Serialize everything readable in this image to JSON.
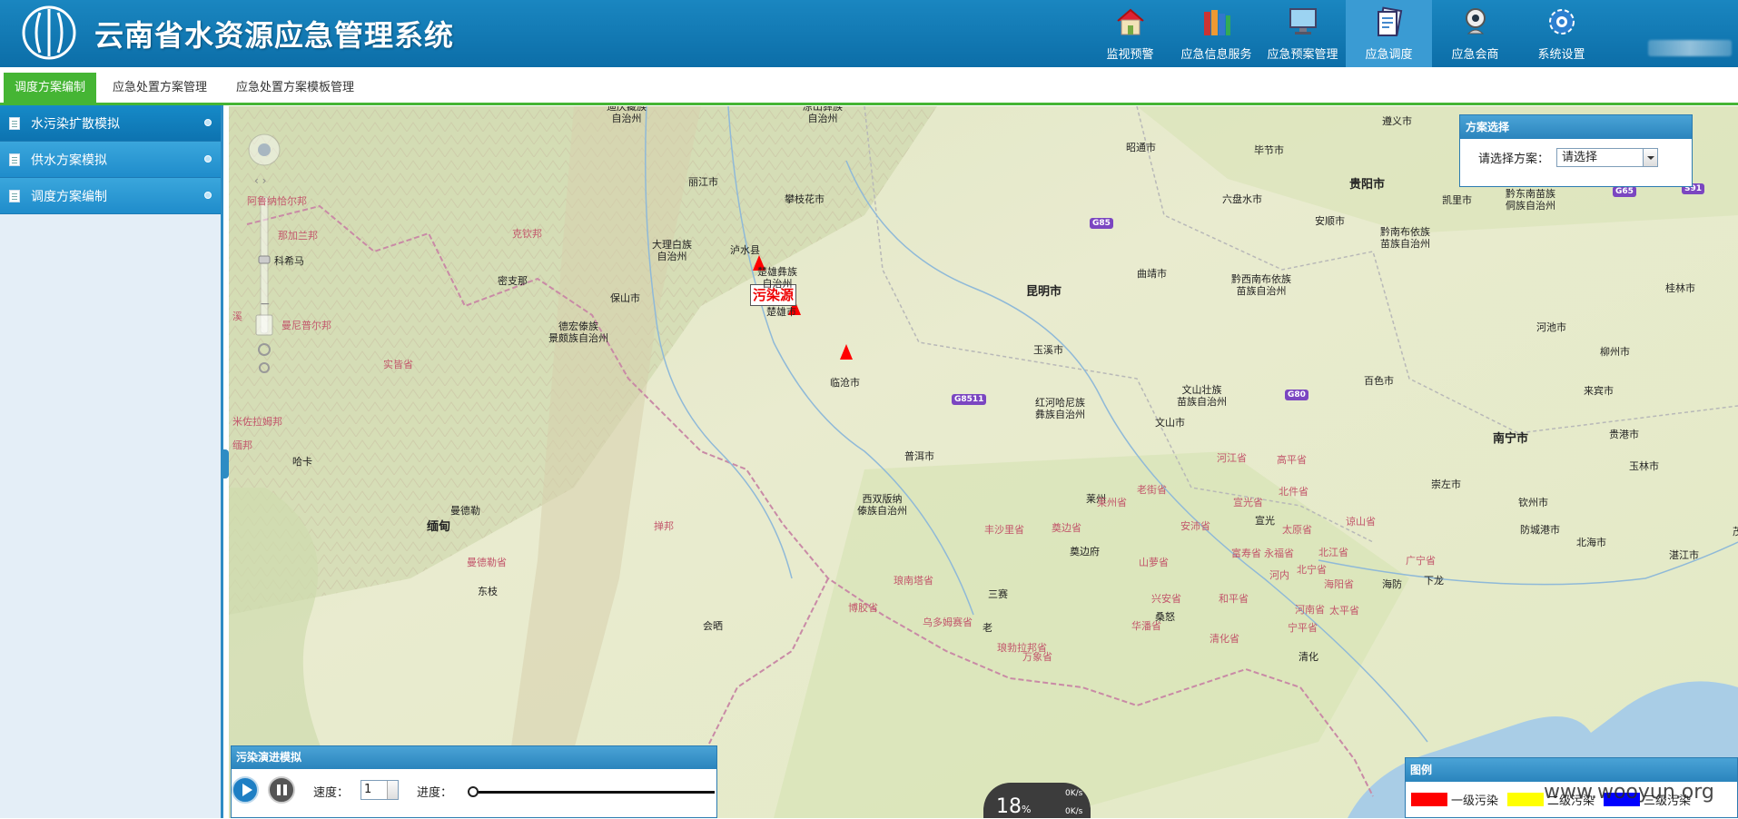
{
  "app": {
    "title": "云南省水资源应急管理系统"
  },
  "nav": [
    {
      "label": "监视预警",
      "icon": "house-icon"
    },
    {
      "label": "应急信息服务",
      "icon": "books-icon"
    },
    {
      "label": "应急预案管理",
      "icon": "monitor-icon"
    },
    {
      "label": "应急调度",
      "icon": "document-icon",
      "active": true
    },
    {
      "label": "应急会商",
      "icon": "webcam-icon"
    },
    {
      "label": "系统设置",
      "icon": "gear-icon"
    }
  ],
  "subtabs": [
    "调度方案编制",
    "应急处置方案管理",
    "应急处置方案模板管理"
  ],
  "sidebar": {
    "items": [
      {
        "label": "水污染扩散模拟"
      },
      {
        "label": "供水方案模拟"
      },
      {
        "label": "调度方案编制"
      }
    ]
  },
  "map": {
    "pollution_source_label": "污染源",
    "places": [
      {
        "name": "迪庆藏族\n自治州"
      },
      {
        "name": "凉山彝族\n自治州"
      },
      {
        "name": "遵义市"
      },
      {
        "name": "昭通市"
      },
      {
        "name": "毕节市"
      },
      {
        "name": "丽江市"
      },
      {
        "name": "贵阳市"
      },
      {
        "name": "攀枝花市"
      },
      {
        "name": "六盘水市"
      },
      {
        "name": "凯里市"
      },
      {
        "name": "黔东南苗族\n侗族自治州"
      },
      {
        "name": "安顺市"
      },
      {
        "name": "黔南布依族\n苗族自治州"
      },
      {
        "name": "大理白族\n自治州"
      },
      {
        "name": "泸水县"
      },
      {
        "name": "科希马"
      },
      {
        "name": "密支那"
      },
      {
        "name": "楚雄彝族\n自治州"
      },
      {
        "name": "曲靖市"
      },
      {
        "name": "黔西南布依族\n苗族自治州"
      },
      {
        "name": "昆明市"
      },
      {
        "name": "桂林市"
      },
      {
        "name": "保山市"
      },
      {
        "name": "楚雄市"
      },
      {
        "name": "德宏傣族\n景颇族自治州"
      },
      {
        "name": "玉溪市"
      },
      {
        "name": "河池市"
      },
      {
        "name": "柳州市"
      },
      {
        "name": "百色市"
      },
      {
        "name": "临沧市"
      },
      {
        "name": "文山壮族\n苗族自治州"
      },
      {
        "name": "来宾市"
      },
      {
        "name": "红河哈尼族\n彝族自治州"
      },
      {
        "name": "文山市"
      },
      {
        "name": "贵港市"
      },
      {
        "name": "南宁市"
      },
      {
        "name": "普洱市"
      },
      {
        "name": "玉林市"
      },
      {
        "name": "崇左市"
      },
      {
        "name": "哈卡"
      },
      {
        "name": "西双版纳\n傣族自治州"
      },
      {
        "name": "莱州"
      },
      {
        "name": "钦州市"
      },
      {
        "name": "曼德勒"
      },
      {
        "name": "缅甸"
      },
      {
        "name": "宣光"
      },
      {
        "name": "防城港市"
      },
      {
        "name": "北海市"
      },
      {
        "name": "湛江市"
      },
      {
        "name": "奠边府"
      },
      {
        "name": "河内"
      },
      {
        "name": "海防"
      },
      {
        "name": "下龙"
      },
      {
        "name": "东枝"
      },
      {
        "name": "三赛"
      },
      {
        "name": "会晒"
      },
      {
        "name": "桑怒"
      },
      {
        "name": "老"
      },
      {
        "name": "清化"
      },
      {
        "name": "茂"
      }
    ],
    "regions": [
      "阿鲁纳恰尔邦",
      "那加兰邦",
      "克钦邦",
      "曼尼普尔邦",
      "实皆省",
      "米佐拉姆邦",
      "掸邦",
      "曼德勒省",
      "琅南塔省",
      "博胶省",
      "乌多姆赛省",
      "丰沙里省",
      "莱州省",
      "奠边省",
      "老街省",
      "安沛省",
      "河江省",
      "高平省",
      "宣光省",
      "北件省",
      "谅山省",
      "太原省",
      "永福省",
      "富寿省",
      "北江省",
      "北宁省",
      "海阳省",
      "广宁省",
      "和平省",
      "山萝省",
      "华潘省",
      "琅勃拉邦省",
      "河南省",
      "太平省",
      "宁平省",
      "清化省",
      "兴安省",
      "万象省",
      "溪",
      "缅邦"
    ],
    "roads": [
      "G85",
      "G65",
      "S91",
      "G8511",
      "G80"
    ]
  },
  "plan_panel": {
    "title": "方案选择",
    "label": "请选择方案：",
    "selected": "请选择"
  },
  "sim_panel": {
    "title": "污染演进模拟",
    "speed_label": "速度：",
    "speed_value": "1",
    "progress_label": "进度：",
    "progress": 0
  },
  "legend_panel": {
    "title": "图例",
    "items": [
      {
        "label": "一级污染",
        "color": "#ff0000"
      },
      {
        "label": "二级污染",
        "color": "#ffff00"
      },
      {
        "label": "三级污染",
        "color": "#0000ff"
      }
    ]
  },
  "gauge": {
    "percent": "18",
    "unit": "%",
    "up": "0K/s",
    "down": "0K/s"
  },
  "watermark": "www.wooyun.org",
  "colors": {
    "header": "#0c6ea8",
    "active_tab": "#45b534",
    "panel_head": "#2a84bd"
  }
}
